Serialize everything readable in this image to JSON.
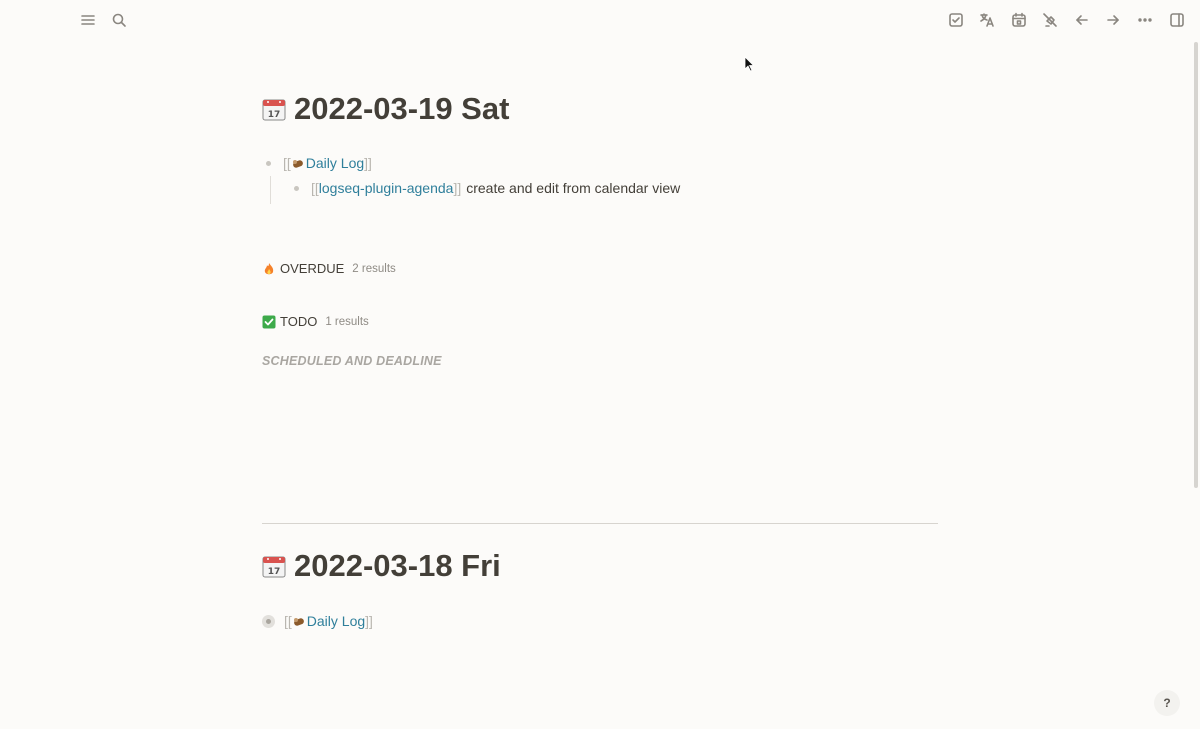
{
  "toolbar": {
    "left": [
      {
        "icon": "menu-icon"
      },
      {
        "icon": "search-icon"
      }
    ],
    "right": [
      {
        "icon": "checkbox-icon"
      },
      {
        "icon": "translate-icon"
      },
      {
        "icon": "calendar-icon"
      },
      {
        "icon": "highlighter-off-icon"
      },
      {
        "icon": "arrow-left-icon"
      },
      {
        "icon": "arrow-right-icon"
      },
      {
        "icon": "more-icon"
      },
      {
        "icon": "sidebar-toggle-icon"
      }
    ]
  },
  "journals": [
    {
      "title": "2022-03-19 Sat",
      "blocks": [
        {
          "open": "[[",
          "ref": "Daily Log",
          "close": "]]"
        },
        {
          "open": "[[",
          "ref": "logseq-plugin-agenda",
          "close": "]]",
          "text": "create and edit from calendar view"
        }
      ]
    },
    {
      "title": "2022-03-18 Fri",
      "blocks": [
        {
          "open": "[[",
          "ref": "Daily Log",
          "close": "]]"
        }
      ]
    }
  ],
  "queries": [
    {
      "label": "OVERDUE",
      "count": "2 results",
      "icon": "fire-emoji"
    },
    {
      "label": "TODO",
      "count": "1 results",
      "icon": "check-mark-emoji"
    }
  ],
  "scheduled_heading": "SCHEDULED AND DEADLINE",
  "help_label": "?",
  "colors": {
    "background": "#fcfbf9",
    "text": "#433f38",
    "page_ref": "#2f7f9b",
    "muted": "#a9a6a1"
  }
}
